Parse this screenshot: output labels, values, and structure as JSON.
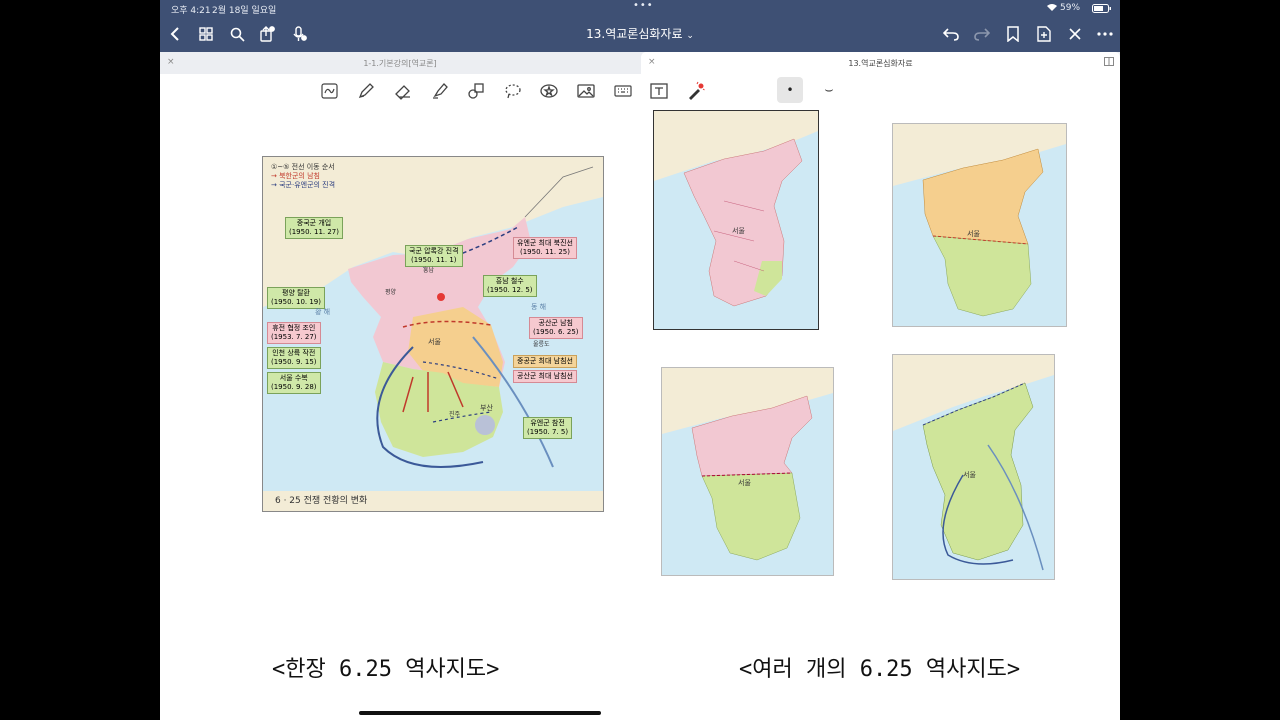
{
  "status": {
    "time": "오후 4:21",
    "date": "2월 18일 일요일",
    "battery": "59%"
  },
  "header": {
    "doc_title": "13.역교론심화자료",
    "title_chevron": "⌄",
    "more_dots": "•••"
  },
  "tabs": [
    {
      "label": "1-1.기본강의[역교론]",
      "active": false,
      "close": "×"
    },
    {
      "label": "13.역교론심화자료",
      "active": true,
      "close": "×"
    }
  ],
  "toolbar": {
    "tools": [
      "lasso-text-icon",
      "pen-icon",
      "eraser-icon",
      "highlighter-icon",
      "shapes-icon",
      "lasso-icon",
      "sticker-icon",
      "image-icon",
      "keyboard-icon",
      "textbox-icon",
      "laser-pointer-icon"
    ],
    "dot_label": "•",
    "curve_label": "⌣"
  },
  "main_map": {
    "legend": [
      "①~⑤ 전선 이동 순서",
      "→ 북한군의 남침",
      "→ 국군·유엔군의 진격"
    ],
    "labels": [
      {
        "text": "중국군 개입",
        "date": "(1950. 11. 27)"
      },
      {
        "text": "국군 압록강 진격",
        "date": "(1950. 11. 1)"
      },
      {
        "text": "유엔군 최대 북진선",
        "date": "(1950. 11. 25)"
      },
      {
        "text": "평양 탈환",
        "date": "(1950. 10. 19)"
      },
      {
        "text": "흥남 철수",
        "date": "(1950. 12. 5)"
      },
      {
        "text": "휴전 협정 조인",
        "date": "(1953. 7. 27)"
      },
      {
        "text": "공산군 남침",
        "date": "(1950. 6. 25)"
      },
      {
        "text": "인천 상륙 작전",
        "date": "(1950. 9. 15)"
      },
      {
        "text": "중공군 최대 남침선",
        "date": ""
      },
      {
        "text": "공산군 최대 남침선",
        "date": ""
      },
      {
        "text": "서울 수복",
        "date": "(1950. 9. 28)"
      },
      {
        "text": "유엔군 참전",
        "date": "(1950. 7. 5)"
      }
    ],
    "sea_labels": [
      "황 해",
      "동 해"
    ],
    "places": [
      "서울",
      "흥남",
      "평양",
      "부산",
      "진주",
      "울릉도"
    ],
    "caption": "6 · 25 전쟁 전황의 변화"
  },
  "small_maps": {
    "city": "서울"
  },
  "captions": {
    "left": "<한장 6.25 역사지도>",
    "right": "<여러 개의 6.25 역사지도>"
  },
  "colors": {
    "header_bg": "#3e5074",
    "north_pink": "#f2c8d2",
    "south_green": "#cfe59a",
    "sea_blue": "#cfe9f4",
    "china_tan": "#f3ecd6",
    "orange": "#f5cf8e"
  }
}
